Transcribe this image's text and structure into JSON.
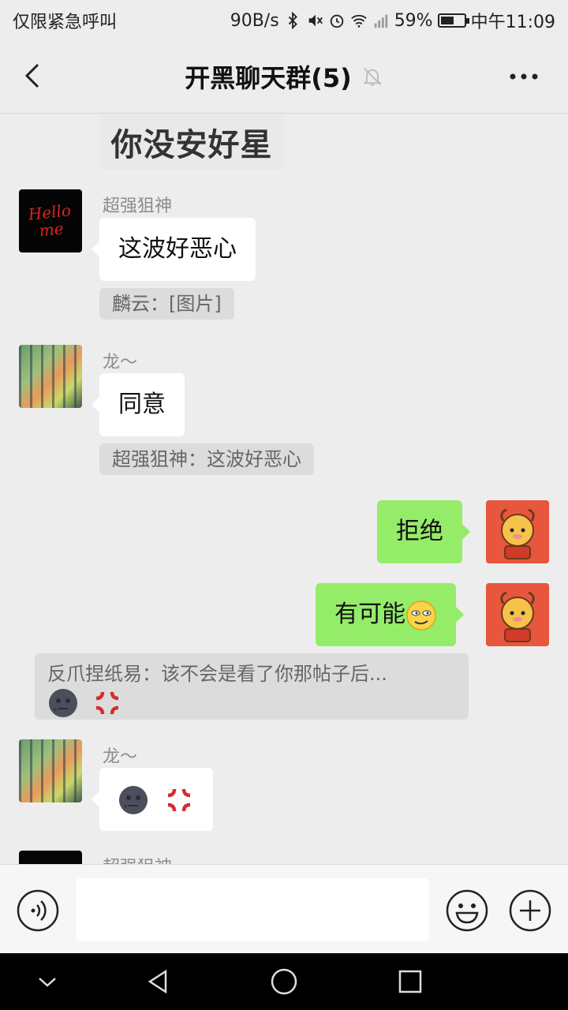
{
  "status_bar": {
    "carrier": "仅限紧急呼叫",
    "speed": "90B/s",
    "battery": "59%",
    "battery_level": 0.59,
    "time": "中午11:09"
  },
  "header": {
    "title": "开黑聊天群(5)"
  },
  "messages": {
    "image_snippet": "你没安好星",
    "m1": {
      "sender": "超强狙神",
      "text": "这波好恶心",
      "quote": "麟云：[图片]"
    },
    "m2": {
      "sender": "龙～",
      "text": "同意",
      "quote": "超强狙神：这波好恶心"
    },
    "m3": {
      "text": "拒绝"
    },
    "m4": {
      "text": "有可能"
    },
    "m4_quote": {
      "text": "反爪捏纸易：该不会是看了你那帖子后..."
    },
    "m5": {
      "sender": "龙～"
    },
    "m6": {
      "sender": "超强狙神"
    }
  },
  "avatars": {
    "hello": "Hello me"
  },
  "input": {
    "value": ""
  },
  "icons": {
    "back": "chevron-left-icon",
    "mute": "bell-off-icon",
    "more": "more-dots-icon",
    "voice": "voice-icon",
    "emoji": "emoji-icon",
    "plus": "plus-icon"
  }
}
